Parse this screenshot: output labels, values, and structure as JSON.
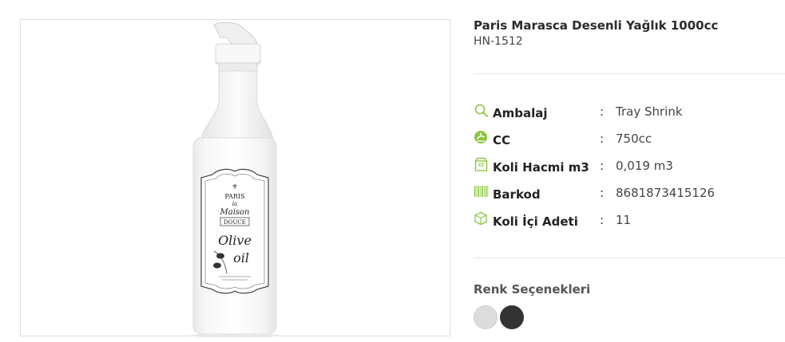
{
  "product": {
    "title": "Paris Marasca Desenli Yağlık 1000cc",
    "sku": "HN-1512",
    "image_alt": "White glass olive oil bottle with Paris Maison Douce Olive oil label",
    "label_text": {
      "line1": "PARIS",
      "line2": "la",
      "line3": "Maison",
      "line4": "DOUCE",
      "line5": "Olive",
      "line6": "oil"
    }
  },
  "specs": [
    {
      "icon": "search-icon",
      "label": "Ambalaj",
      "sep": ":",
      "value": "Tray Shrink"
    },
    {
      "icon": "cc-icon",
      "label": "CC",
      "sep": ":",
      "value": "750cc"
    },
    {
      "icon": "box-icon",
      "label": "Koli Hacmi m3",
      "sep": ":",
      "value": "0,019 m3"
    },
    {
      "icon": "barcode-icon",
      "label": "Barkod",
      "sep": ":",
      "value": "8681873415126"
    },
    {
      "icon": "package-icon",
      "label": "Koli İçi Adeti",
      "sep": ":",
      "value": "11"
    }
  ],
  "colors": {
    "title": "Renk Seçenekleri",
    "options": [
      {
        "name": "light-gray",
        "hex": "#dcdcdc"
      },
      {
        "name": "dark-gray",
        "hex": "#333333"
      }
    ]
  },
  "theme": {
    "icon_color": "#8cc63f",
    "frame_border": "#e6d8dc"
  }
}
